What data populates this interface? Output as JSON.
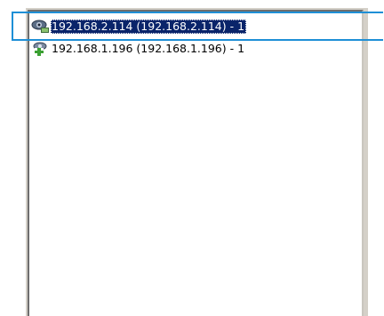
{
  "colors": {
    "selection": "#0a246a",
    "highlight": "#1e8fd6"
  },
  "list": {
    "items": [
      {
        "label": "192.168.2.114 (192.168.2.114) - 1",
        "icon": "eye-icon",
        "selected": true
      },
      {
        "label": "192.168.1.196 (192.168.1.196) - 1",
        "icon": "connect-plus-icon",
        "selected": false
      }
    ]
  }
}
